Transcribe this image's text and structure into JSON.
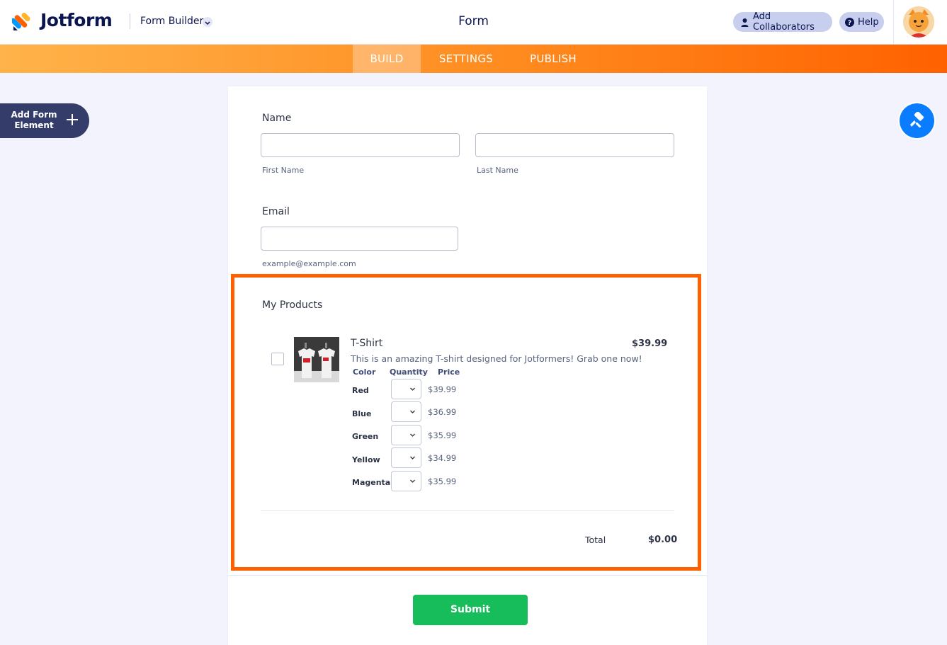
{
  "header": {
    "brand": "Jotform",
    "builder_label": "Form Builder",
    "form_title": "Form",
    "add_collaborators": "Add Collaborators",
    "help": "Help"
  },
  "nav": {
    "tabs": [
      {
        "label": "BUILD",
        "active": true
      },
      {
        "label": "SETTINGS",
        "active": false
      },
      {
        "label": "PUBLISH",
        "active": false
      }
    ]
  },
  "sidebar": {
    "add_element_label": "Add Form Element"
  },
  "form": {
    "name": {
      "label": "Name",
      "first_sublabel": "First Name",
      "last_sublabel": "Last Name",
      "first_value": "",
      "last_value": ""
    },
    "email": {
      "label": "Email",
      "sublabel": "example@example.com",
      "value": ""
    },
    "products": {
      "label": "My Products",
      "item": {
        "title": "T-Shirt",
        "price": "$39.99",
        "description": "This is an amazing T-shirt designed for Jotformers! Grab one now!",
        "checked": false,
        "columns": [
          "Color",
          "Quantity",
          "Price"
        ],
        "options": [
          {
            "color": "Red",
            "price": "$39.99"
          },
          {
            "color": "Blue",
            "price": "$36.99"
          },
          {
            "color": "Green",
            "price": "$35.99"
          },
          {
            "color": "Yellow",
            "price": "$34.99"
          },
          {
            "color": "Magenta",
            "price": "$35.99"
          }
        ]
      },
      "total_label": "Total",
      "total_value": "$0.00"
    },
    "submit_label": "Submit"
  },
  "colors": {
    "accent_orange": "#ff6100",
    "submit_green": "#18bd5b",
    "designer_blue": "#0a7cff",
    "navy": "#0a1551"
  }
}
